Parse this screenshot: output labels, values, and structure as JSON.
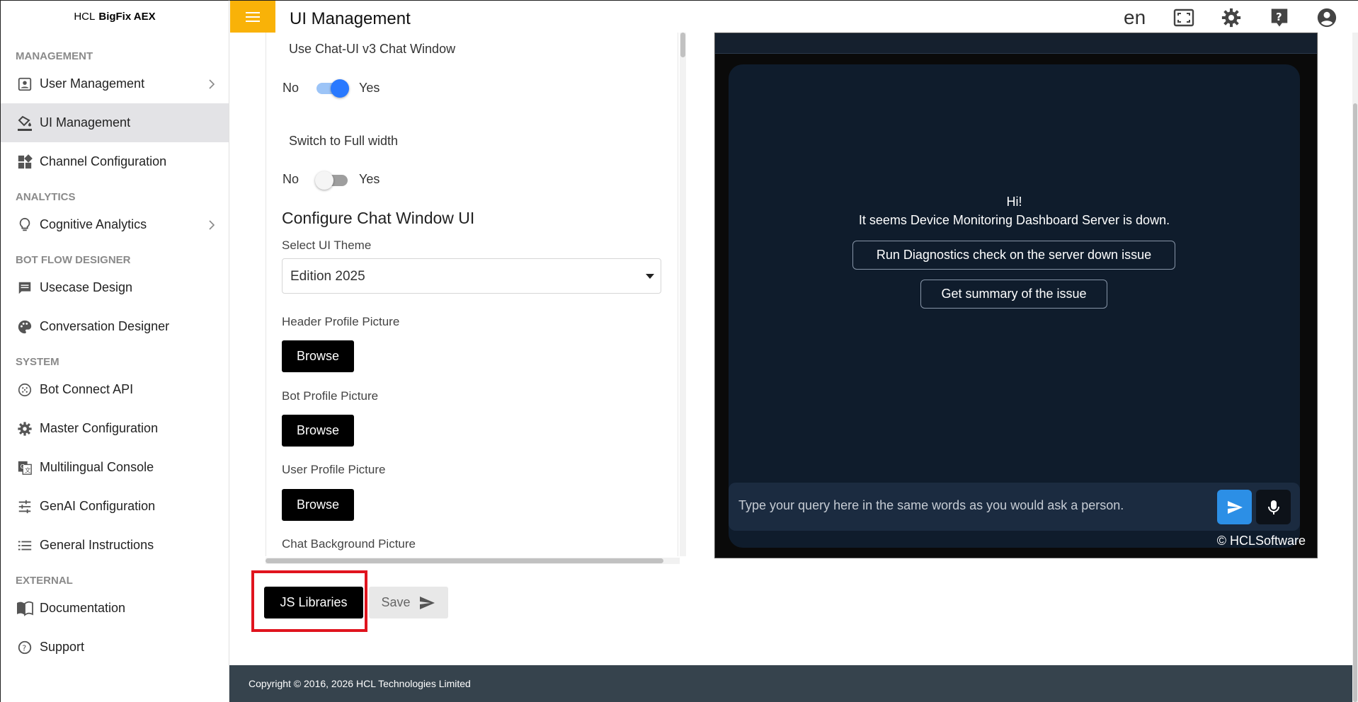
{
  "brand": {
    "prefix": "HCL",
    "product": "BigFix AEX"
  },
  "header": {
    "title": "UI Management",
    "language": "en",
    "icons": [
      "fullscreen-icon",
      "settings-icon",
      "help-icon",
      "account-icon"
    ]
  },
  "sidebar": {
    "sections": [
      {
        "title": "MANAGEMENT",
        "items": [
          {
            "label": "User Management",
            "icon": "user-management-icon",
            "expandable": true
          },
          {
            "label": "UI Management",
            "icon": "paint-bucket-icon",
            "active": true
          },
          {
            "label": "Channel Configuration",
            "icon": "widgets-icon"
          }
        ]
      },
      {
        "title": "ANALYTICS",
        "items": [
          {
            "label": "Cognitive Analytics",
            "icon": "lightbulb-icon",
            "expandable": true
          }
        ]
      },
      {
        "title": "BOT FLOW DESIGNER",
        "items": [
          {
            "label": "Usecase Design",
            "icon": "comment-icon"
          },
          {
            "label": "Conversation Designer",
            "icon": "palette-icon"
          }
        ]
      },
      {
        "title": "SYSTEM",
        "items": [
          {
            "label": "Bot Connect API",
            "icon": "dial-icon"
          },
          {
            "label": "Master Configuration",
            "icon": "gear-icon"
          },
          {
            "label": "Multilingual Console",
            "icon": "translate-icon"
          },
          {
            "label": "GenAI Configuration",
            "icon": "tune-icon"
          },
          {
            "label": "General Instructions",
            "icon": "list-icon"
          }
        ]
      },
      {
        "title": "EXTERNAL",
        "items": [
          {
            "label": "Documentation",
            "icon": "book-icon"
          },
          {
            "label": "Support",
            "icon": "support-icon"
          }
        ]
      }
    ]
  },
  "settings": {
    "chat_v3": {
      "label": "Use Chat-UI v3 Chat Window",
      "no": "No",
      "yes": "Yes",
      "enabled": true
    },
    "full_width": {
      "label": "Switch to Full width",
      "no": "No",
      "yes": "Yes",
      "enabled": false
    },
    "configure_heading": "Configure Chat Window UI",
    "theme": {
      "label": "Select UI Theme",
      "value": "Edition 2025"
    },
    "header_picture": {
      "label": "Header Profile Picture",
      "button": "Browse"
    },
    "bot_picture": {
      "label": "Bot Profile Picture",
      "button": "Browse"
    },
    "user_picture": {
      "label": "User Profile Picture",
      "button": "Browse"
    },
    "background_picture": {
      "label": "Chat Background Picture"
    }
  },
  "actions": {
    "js_libraries": "JS Libraries",
    "save": "Save"
  },
  "chat_preview": {
    "greeting_line1": "Hi!",
    "greeting_line2": "It seems Device Monitoring Dashboard Server is down.",
    "suggestions": [
      "Run Diagnostics check on the server down issue",
      "Get summary of the issue"
    ],
    "input_placeholder": "Type your query here in the same words as you would ask a person.",
    "copyright": "© HCLSoftware"
  },
  "footer": {
    "text": "Copyright © 2016, 2026 HCL Technologies Limited"
  },
  "colors": {
    "accent": "#f9b208",
    "toggle_on": "#2979ff",
    "footer_bg": "#36434d",
    "chat_bg": "#0f1c2c",
    "send_button": "#2c8fe6",
    "highlight": "#e0141e"
  }
}
